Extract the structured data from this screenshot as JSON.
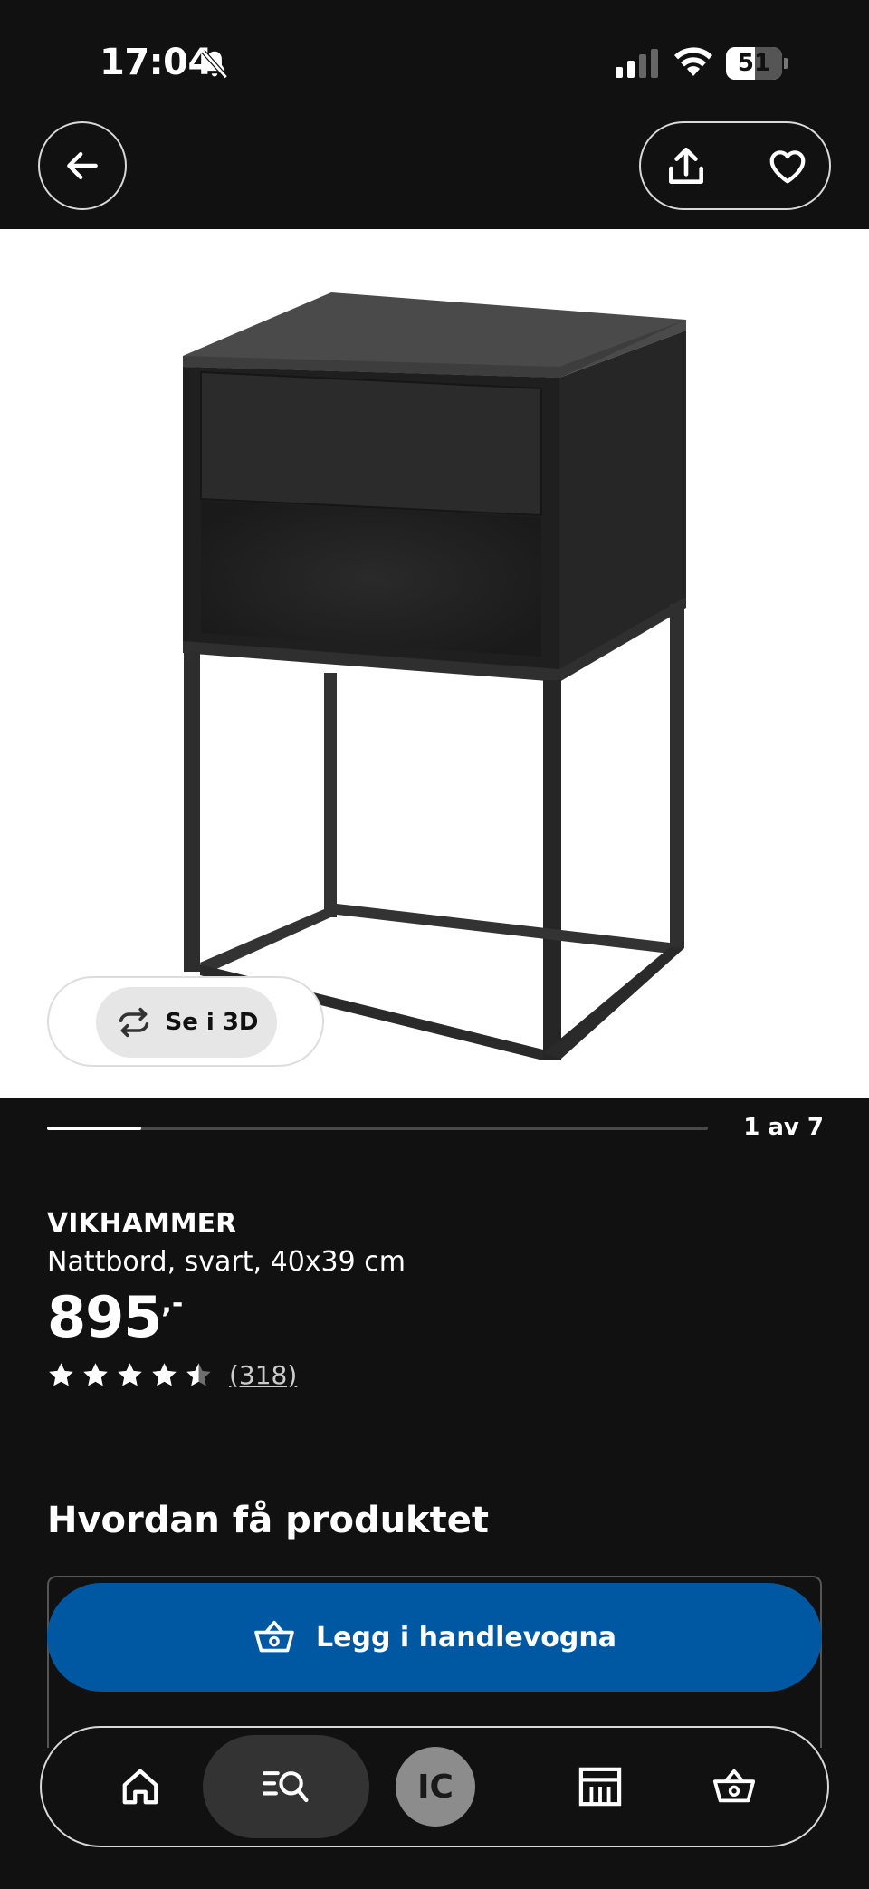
{
  "status_bar": {
    "time": "17:04",
    "battery_level": 51,
    "battery_text": "51",
    "icons": [
      "bell-slash-icon",
      "signal-icon",
      "wifi-icon",
      "battery-icon"
    ]
  },
  "header": {
    "icons": [
      "arrow-left-icon",
      "share-icon",
      "heart-icon"
    ]
  },
  "gallery": {
    "view_3d_label": "Se i 3D",
    "view_3d_icon": "rotate-icon",
    "current_image": 1,
    "total_images": 7,
    "progress_text": "1 av 7"
  },
  "product": {
    "name": "VIKHAMMER",
    "description": "Nattbord, svart, 40x39 cm",
    "price": "895",
    "price_suffix": ",-",
    "rating": 4.5,
    "rating_max": 5,
    "review_count": "(318)"
  },
  "availability": {
    "title": "Hvordan få produktet",
    "add_to_cart_label": "Legg i handlevogna",
    "add_to_cart_icon": "basket-icon"
  },
  "bottom_nav": {
    "items": [
      {
        "name": "home",
        "icon": "home-icon"
      },
      {
        "name": "search",
        "icon": "search-list-icon",
        "active": true
      },
      {
        "name": "profile",
        "icon": "avatar",
        "initials": "IC"
      },
      {
        "name": "stores",
        "icon": "store-icon"
      },
      {
        "name": "cart",
        "icon": "basket-icon"
      }
    ]
  },
  "colors": {
    "background": "#111111",
    "primary_button": "#0058a3",
    "text": "#ffffff"
  }
}
